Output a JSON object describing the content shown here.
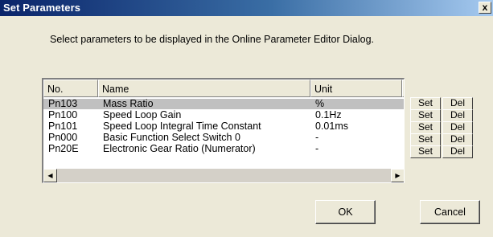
{
  "window": {
    "title": "Set Parameters",
    "close_glyph": "x"
  },
  "instructions": "Select parameters to be displayed in the Online Parameter Editor Dialog.",
  "table": {
    "columns": [
      "No.",
      "Name",
      "Unit"
    ],
    "rows": [
      {
        "no": "Pn103",
        "name": "Mass Ratio",
        "unit": "%",
        "selected": true
      },
      {
        "no": "Pn100",
        "name": "Speed Loop Gain",
        "unit": "0.1Hz",
        "selected": false
      },
      {
        "no": "Pn101",
        "name": "Speed Loop Integral Time Constant",
        "unit": "0.01ms",
        "selected": false
      },
      {
        "no": "Pn000",
        "name": "Basic Function Select Switch 0",
        "unit": "-",
        "selected": false
      },
      {
        "no": "Pn20E",
        "name": "Electronic Gear Ratio (Numerator)",
        "unit": "-",
        "selected": false
      }
    ]
  },
  "row_buttons": {
    "set_label": "Set",
    "del_label": "Del"
  },
  "scrollbar": {
    "left_glyph": "◀",
    "right_glyph": "▶"
  },
  "buttons": {
    "ok_label": "OK",
    "cancel_label": "Cancel"
  }
}
